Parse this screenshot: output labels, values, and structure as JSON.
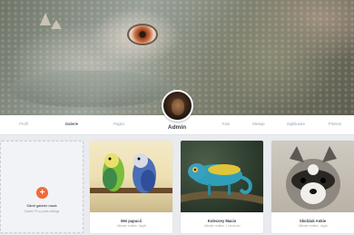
{
  "profile": {
    "username": "Admin"
  },
  "nav": {
    "items": [
      {
        "label": "Profil",
        "active": false
      },
      {
        "label": "Galerie",
        "active": true
      },
      {
        "label": "Pagini",
        "active": false
      },
      {
        "label": "Fani",
        "active": false
      },
      {
        "label": "Mesaje",
        "active": false
      },
      {
        "label": "Sighiturare",
        "active": false
      },
      {
        "label": "Prieteni",
        "active": false
      }
    ]
  },
  "create_gallery": {
    "title": "Cărei galerie nouă",
    "subtitle": "Galerie Pi va poate adăuga",
    "icon": "plus-icon",
    "accent": "#f06a3b"
  },
  "galleries": [
    {
      "name": "Mei papucii",
      "meta": "Ultimele redărie, Vaglă"
    },
    {
      "name": "Kolecsey Macio",
      "meta": "Ultimele redărie, 1 vizual ăni"
    },
    {
      "name": "Skolziak Ankie",
      "meta": "Ultimele redărie, Vaglă"
    }
  ]
}
